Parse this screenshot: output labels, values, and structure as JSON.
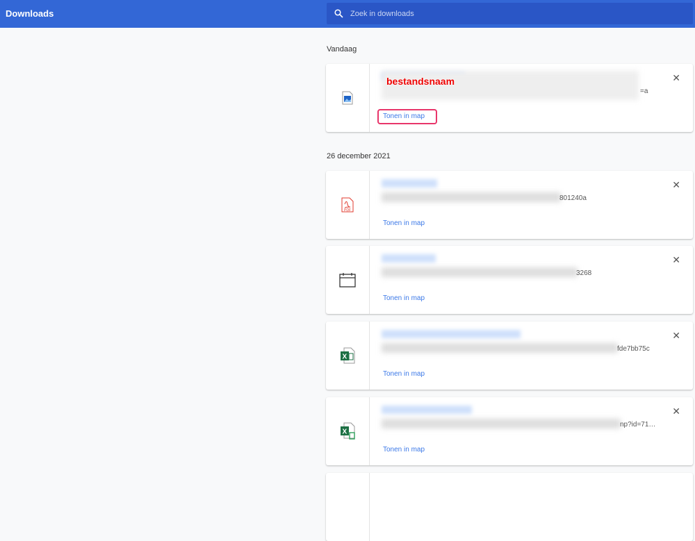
{
  "header": {
    "title": "Downloads",
    "search_placeholder": "Zoek in downloads"
  },
  "groups": [
    {
      "date": "Vandaag"
    },
    {
      "date": "26 december 2021"
    }
  ],
  "items": [
    {
      "icon": "image-file-icon",
      "url_tail": "=a",
      "action": "Tonen in map",
      "annotation": "bestandsnaam"
    },
    {
      "icon": "pdf-file-icon",
      "url_tail": "801240a",
      "action": "Tonen in map"
    },
    {
      "icon": "calendar-file-icon",
      "url_tail": "3268",
      "action": "Tonen in map"
    },
    {
      "icon": "excel-file-icon",
      "url_tail": "fde7bb75c",
      "action": "Tonen in map"
    },
    {
      "icon": "excel-file-icon",
      "url_tail": "np?id=71…",
      "action": "Tonen in map"
    }
  ],
  "close_glyph": "✕",
  "colors": {
    "header": "#3367d6",
    "link": "#3b78e7",
    "highlight": "#e8356a"
  }
}
